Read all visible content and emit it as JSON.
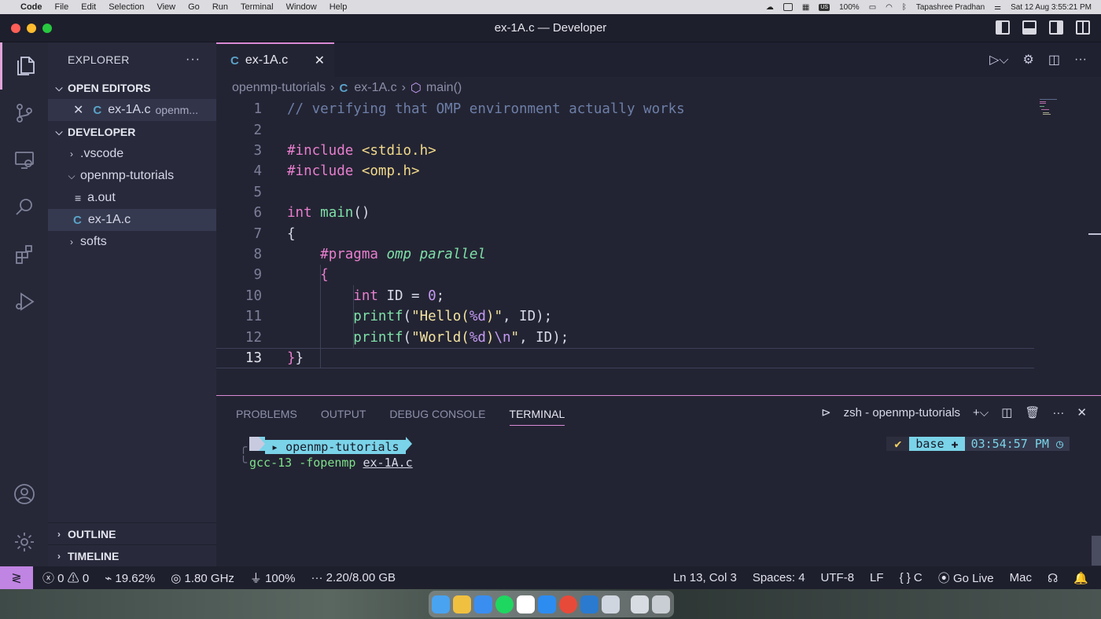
{
  "menubar": {
    "app": "Code",
    "items": [
      "File",
      "Edit",
      "Selection",
      "View",
      "Go",
      "Run",
      "Terminal",
      "Window",
      "Help"
    ],
    "battery": "100%",
    "user": "Tapashree Pradhan",
    "datetime": "Sat 12 Aug  3:55:21 PM",
    "input_badge": "US"
  },
  "window": {
    "title": "ex-1A.c — Developer"
  },
  "sidebar": {
    "title": "EXPLORER",
    "more": "···",
    "open_editors_label": "OPEN EDITORS",
    "open_editor_file": "ex-1A.c",
    "open_editor_path": "openm...",
    "workspace_label": "DEVELOPER",
    "tree": [
      {
        "label": ".vscode"
      },
      {
        "label": "openmp-tutorials"
      },
      {
        "label": "a.out"
      },
      {
        "label": "ex-1A.c"
      },
      {
        "label": "softs"
      }
    ],
    "outline_label": "OUTLINE",
    "timeline_label": "TIMELINE"
  },
  "tab": {
    "label": "ex-1A.c",
    "icon": "C"
  },
  "breadcrumb": {
    "folder": "openmp-tutorials",
    "file": "ex-1A.c",
    "symbol": "main()"
  },
  "editor": {
    "current_line": 13,
    "line_numbers": [
      "1",
      "2",
      "3",
      "4",
      "5",
      "6",
      "7",
      "8",
      "9",
      "10",
      "11",
      "12",
      "13"
    ],
    "code": {
      "l1": "// verifying that OMP environment actually works",
      "l3_kw": "#include",
      "l3_hd": "<stdio.h>",
      "l4_kw": "#include",
      "l4_hd": "<omp.h>",
      "l6_kw": "int",
      "l6_fn": "main",
      "l6_rest": "()",
      "l7": "{",
      "l8_kw": "#pragma",
      "l8_it": "omp parallel",
      "l9": "{",
      "l10_kw": "int",
      "l10_rest": " ID = ",
      "l10_num": "0",
      "l10_end": ";",
      "l11_fn": "printf",
      "l11_a": "(",
      "l11_s1": "\"Hello(",
      "l11_esc": "%d",
      "l11_s2": ")\"",
      "l11_end": ", ID);",
      "l12_fn": "printf",
      "l12_a": "(",
      "l12_s1": "\"World(",
      "l12_esc": "%d",
      "l12_s2": ")",
      "l12_esc2": "\\n",
      "l12_s3": "\"",
      "l12_end": ", ID);",
      "l13_br": "}",
      "l13_rest": "}"
    }
  },
  "panel": {
    "tabs": [
      "PROBLEMS",
      "OUTPUT",
      "DEBUG CONSOLE",
      "TERMINAL"
    ],
    "active_tab": "TERMINAL",
    "shell": "zsh - openmp-tutorials",
    "prompt_dir": "openmp-tutorials",
    "command_name": "gcc-13",
    "command_flag": "-fopenmp",
    "command_file": "ex-1A.c",
    "prompt_check": "✔",
    "prompt_env": "base",
    "prompt_time": "03:54:57 PM"
  },
  "statusbar": {
    "errors": "0",
    "warnings": "0",
    "cpu": "19.62%",
    "freq": "1.80 GHz",
    "power": "100%",
    "memory": "2.20/8.00 GB",
    "position": "Ln 13, Col 3",
    "spaces": "Spaces: 4",
    "encoding": "UTF-8",
    "eol": "LF",
    "language": "C",
    "golive": "Go Live",
    "platform": "Mac"
  },
  "colors": {
    "accent": "#d98ad5",
    "remote": "#c084e2",
    "keyword": "#e87fce",
    "function": "#7ee0a8",
    "string": "#f3e3a0"
  }
}
